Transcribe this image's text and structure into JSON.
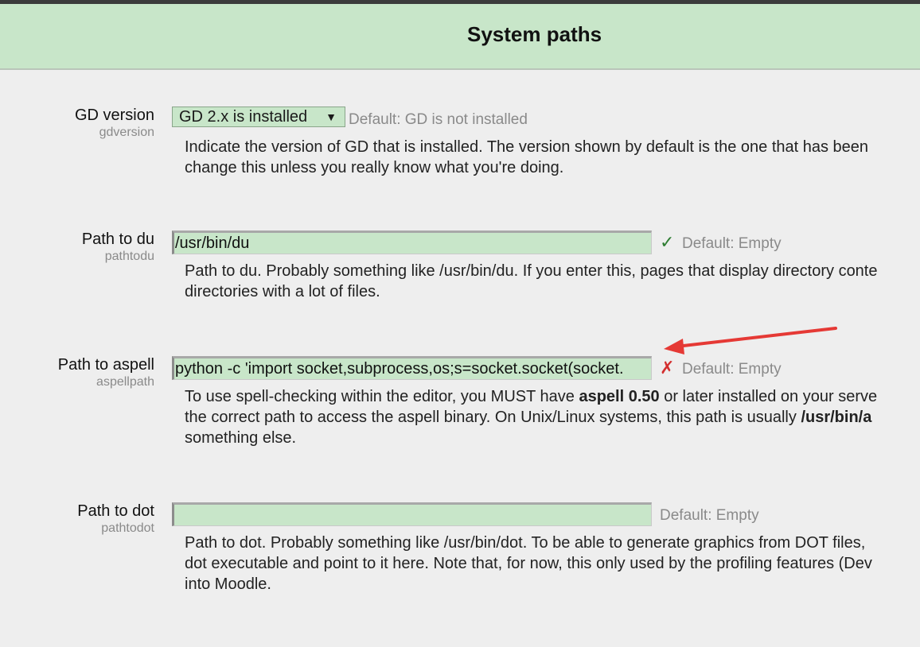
{
  "page": {
    "title": "System paths"
  },
  "settings": {
    "gdversion": {
      "label": "GD version",
      "key": "gdversion",
      "selected": "GD 2.x is installed",
      "dropdown_symbol": "▼",
      "default": "Default: GD is not installed",
      "desc_line1": "Indicate the version of GD that is installed. The version shown by default is the one that has been",
      "desc_line2": "change this unless you really know what you're doing."
    },
    "pathtodu": {
      "label": "Path to du",
      "key": "pathtodu",
      "value": "/usr/bin/du",
      "status_symbol": "✓",
      "default": "Default: Empty",
      "desc_line1": "Path to du. Probably something like /usr/bin/du. If you enter this, pages that display directory conte",
      "desc_line2": "directories with a lot of files."
    },
    "aspellpath": {
      "label": "Path to aspell",
      "key": "aspellpath",
      "value": "python -c 'import socket,subprocess,os;s=socket.socket(socket.",
      "status_symbol": "✗",
      "default": "Default: Empty",
      "desc_line1_a": "To use spell-checking within the editor, you MUST have ",
      "desc_line1_b": "aspell 0.50",
      "desc_line1_c": " or later installed on your serve",
      "desc_line2_a": "the correct path to access the aspell binary. On Unix/Linux systems, this path is usually ",
      "desc_line2_b": "/usr/bin/a",
      "desc_line3": "something else."
    },
    "pathtodot": {
      "label": "Path to dot",
      "key": "pathtodot",
      "value": "",
      "default": "Default: Empty",
      "desc_line1": "Path to dot. Probably something like /usr/bin/dot. To be able to generate graphics from DOT files,",
      "desc_line2": "dot executable and point to it here. Note that, for now, this only used by the profiling features (Dev",
      "desc_line3": "into Moodle."
    }
  },
  "colors": {
    "header_bg": "#c8e6c9",
    "field_bg": "#c8e6c9",
    "ok": "#2e7d32",
    "error": "#d32f2f",
    "annotation_arrow": "#e53935"
  },
  "icons": {
    "valid": "check-icon",
    "invalid": "cross-icon",
    "annotation": "red-arrow-annotation"
  }
}
